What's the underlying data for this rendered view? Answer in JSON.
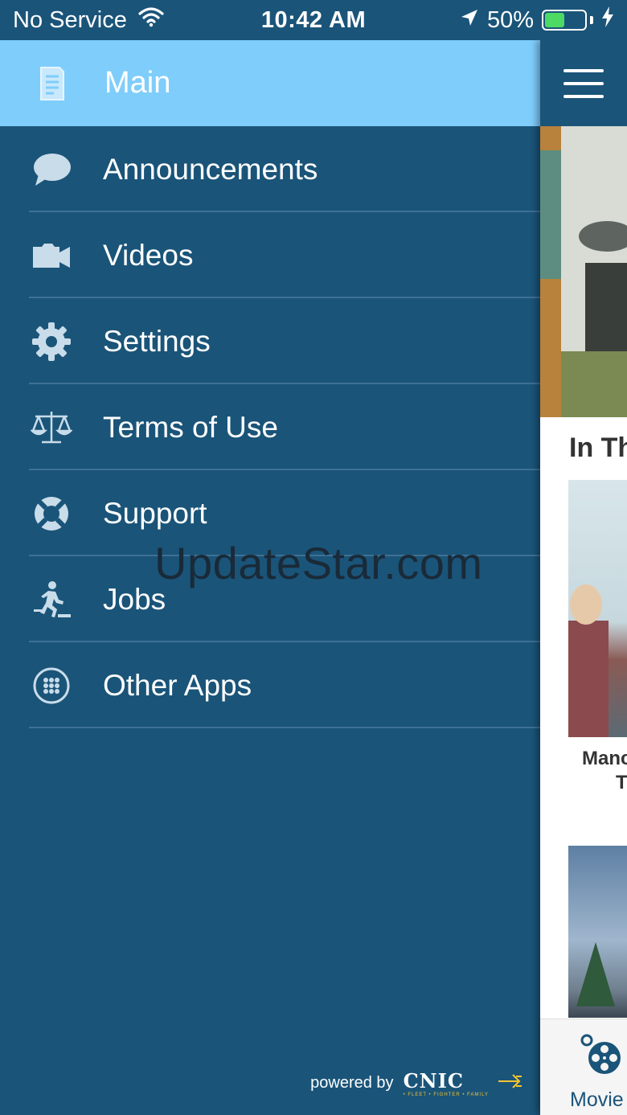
{
  "status_bar": {
    "carrier": "No Service",
    "time": "10:42 AM",
    "battery": "50%",
    "battery_level": 0.5,
    "icons": [
      "wifi-icon",
      "location-arrow-icon",
      "battery-icon",
      "charging-bolt-icon"
    ],
    "battery_color": "#4cd964"
  },
  "drawer": {
    "header": {
      "label": "Main",
      "icon": "document-icon"
    },
    "items": [
      {
        "label": "Announcements",
        "icon": "speech-bubble-icon"
      },
      {
        "label": "Videos",
        "icon": "video-camera-icon"
      },
      {
        "label": "Settings",
        "icon": "gear-icon"
      },
      {
        "label": "Terms of Use",
        "icon": "scales-icon"
      },
      {
        "label": "Support",
        "icon": "life-ring-icon"
      },
      {
        "label": "Jobs",
        "icon": "runner-icon"
      },
      {
        "label": "Other Apps",
        "icon": "app-grid-icon"
      }
    ],
    "footer": {
      "powered_by": "powered by",
      "logo_text": "CNIC",
      "logo_tagline": "• FLEET • FIGHTER • FAMILY"
    }
  },
  "watermark": "UpdateStar.com",
  "main": {
    "section_title": "In Th",
    "movie1_title": "Manc",
    "movie1_sub": "T",
    "tab_label": "Movie",
    "icons": [
      "hamburger-menu-icon",
      "film-reel-icon"
    ]
  },
  "colors": {
    "drawer_bg": "#1a5479",
    "header_bg": "#7fcdfb",
    "divider": "#3e7195",
    "icon": "#c9dce9"
  }
}
